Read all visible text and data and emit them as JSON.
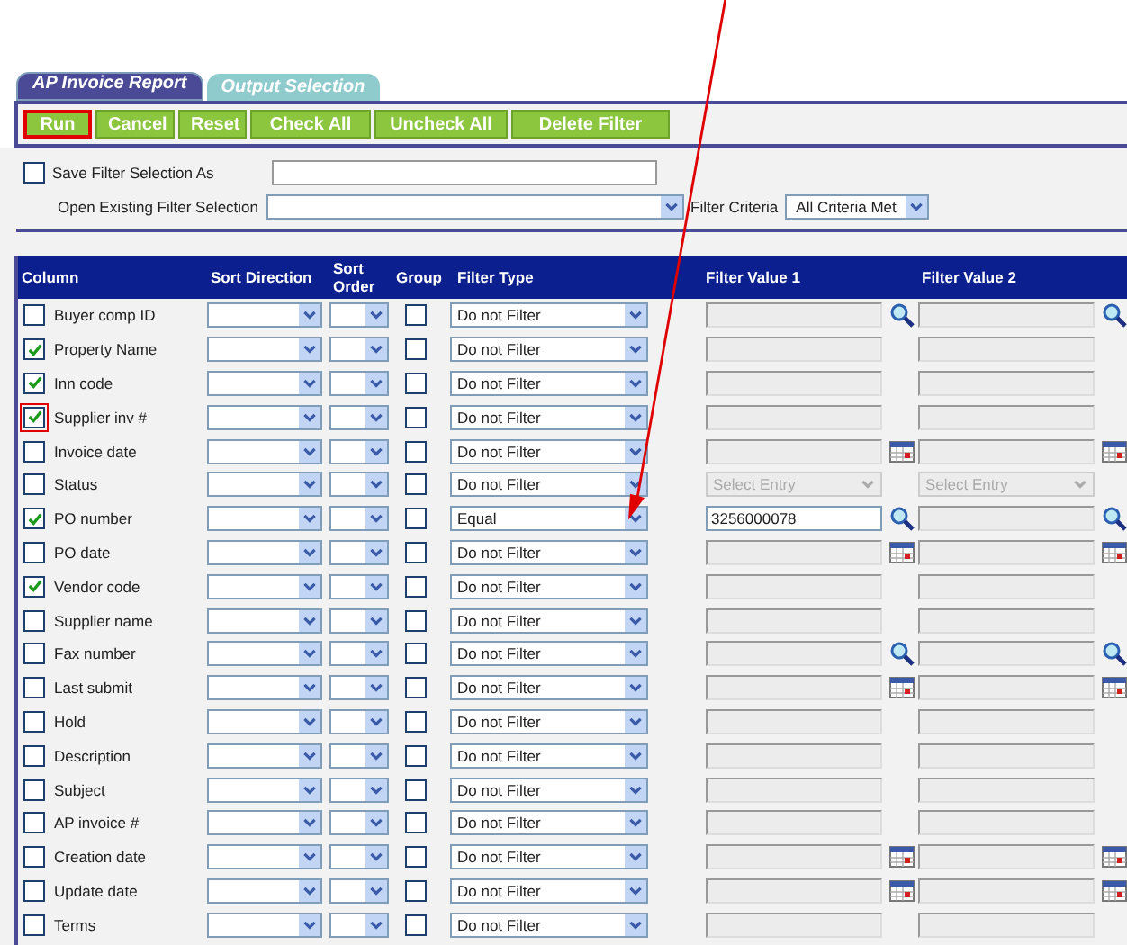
{
  "tabs": [
    {
      "label": "AP Invoice Report",
      "selected": true
    },
    {
      "label": "Output Selection",
      "selected": false
    }
  ],
  "buttons": [
    {
      "label": "Run",
      "highlighted": true
    },
    {
      "label": "Cancel",
      "highlighted": false
    },
    {
      "label": "Reset",
      "highlighted": false
    },
    {
      "label": "Check All",
      "highlighted": false
    },
    {
      "label": "Uncheck All",
      "highlighted": false
    },
    {
      "label": "Delete Filter",
      "highlighted": false
    }
  ],
  "save_filter": {
    "label": "Save Filter Selection As",
    "checked": false
  },
  "open_filter": {
    "label": "Open Existing Filter Selection"
  },
  "filter_criteria": {
    "label": "Filter Criteria",
    "value": "All Criteria Met"
  },
  "columns": [
    "Column",
    "Sort Direction",
    "Sort Order",
    "Group",
    "Filter Type",
    "Filter Value 1",
    "Filter Value 2"
  ],
  "rows": [
    {
      "label": "Buyer comp ID",
      "checked": false,
      "highlighted": false,
      "grouped": false,
      "filter_type": "Do not Filter",
      "kind": "text",
      "enabled": false,
      "search_button": true,
      "calendar_button": false
    },
    {
      "label": "Property Name",
      "checked": true,
      "highlighted": false,
      "grouped": false,
      "filter_type": "Do not Filter",
      "kind": "text",
      "enabled": false,
      "search_button": false,
      "calendar_button": false
    },
    {
      "label": "Inn code",
      "checked": true,
      "highlighted": false,
      "grouped": false,
      "filter_type": "Do not Filter",
      "kind": "text",
      "enabled": false,
      "search_button": false,
      "calendar_button": false
    },
    {
      "label": "Supplier inv #",
      "checked": true,
      "highlighted": true,
      "grouped": false,
      "filter_type": "Do not Filter",
      "kind": "text",
      "enabled": false,
      "search_button": false,
      "calendar_button": false
    },
    {
      "label": "Invoice date",
      "checked": false,
      "highlighted": false,
      "grouped": false,
      "filter_type": "Do not Filter",
      "kind": "text",
      "enabled": false,
      "search_button": false,
      "calendar_button": true
    },
    {
      "label": "Status",
      "checked": false,
      "highlighted": false,
      "grouped": false,
      "filter_type": "Do not Filter",
      "kind": "select",
      "enabled": false,
      "search_button": false,
      "calendar_button": false,
      "value_1": "Select Entry",
      "value_2": "Select Entry"
    },
    {
      "label": "PO number",
      "checked": true,
      "highlighted": false,
      "grouped": false,
      "filter_type": "Equal",
      "kind": "text",
      "enabled": true,
      "search_button": true,
      "calendar_button": false,
      "value_1": "3256000078",
      "arrow_pointer": true
    },
    {
      "label": "PO date",
      "checked": false,
      "highlighted": false,
      "grouped": false,
      "filter_type": "Do not Filter",
      "kind": "text",
      "enabled": false,
      "search_button": false,
      "calendar_button": true
    },
    {
      "label": "Vendor code",
      "checked": true,
      "highlighted": false,
      "grouped": false,
      "filter_type": "Do not Filter",
      "kind": "text",
      "enabled": false,
      "search_button": false,
      "calendar_button": false
    },
    {
      "label": "Supplier name",
      "checked": false,
      "highlighted": false,
      "grouped": false,
      "filter_type": "Do not Filter",
      "kind": "text",
      "enabled": false,
      "search_button": false,
      "calendar_button": false
    },
    {
      "label": "Fax number",
      "checked": false,
      "highlighted": false,
      "grouped": false,
      "filter_type": "Do not Filter",
      "kind": "text",
      "enabled": false,
      "search_button": true,
      "calendar_button": false
    },
    {
      "label": "Last submit",
      "checked": false,
      "highlighted": false,
      "grouped": false,
      "filter_type": "Do not Filter",
      "kind": "text",
      "enabled": false,
      "search_button": false,
      "calendar_button": true
    },
    {
      "label": "Hold",
      "checked": false,
      "highlighted": false,
      "grouped": false,
      "filter_type": "Do not Filter",
      "kind": "text",
      "enabled": false,
      "search_button": false,
      "calendar_button": false
    },
    {
      "label": "Description",
      "checked": false,
      "highlighted": false,
      "grouped": false,
      "filter_type": "Do not Filter",
      "kind": "text",
      "enabled": false,
      "search_button": false,
      "calendar_button": false
    },
    {
      "label": "Subject",
      "checked": false,
      "highlighted": false,
      "grouped": false,
      "filter_type": "Do not Filter",
      "kind": "text",
      "enabled": false,
      "search_button": false,
      "calendar_button": false
    },
    {
      "label": "AP invoice #",
      "checked": false,
      "highlighted": false,
      "grouped": false,
      "filter_type": "Do not Filter",
      "kind": "text",
      "enabled": false,
      "search_button": false,
      "calendar_button": false
    },
    {
      "label": "Creation date",
      "checked": false,
      "highlighted": false,
      "grouped": false,
      "filter_type": "Do not Filter",
      "kind": "text",
      "enabled": false,
      "search_button": false,
      "calendar_button": true
    },
    {
      "label": "Update date",
      "checked": false,
      "highlighted": false,
      "grouped": false,
      "filter_type": "Do not Filter",
      "kind": "text",
      "enabled": false,
      "search_button": false,
      "calendar_button": true
    },
    {
      "label": "Terms",
      "checked": false,
      "highlighted": false,
      "grouped": false,
      "filter_type": "Do not Filter",
      "kind": "text",
      "enabled": false,
      "search_button": false,
      "calendar_button": false
    }
  ]
}
